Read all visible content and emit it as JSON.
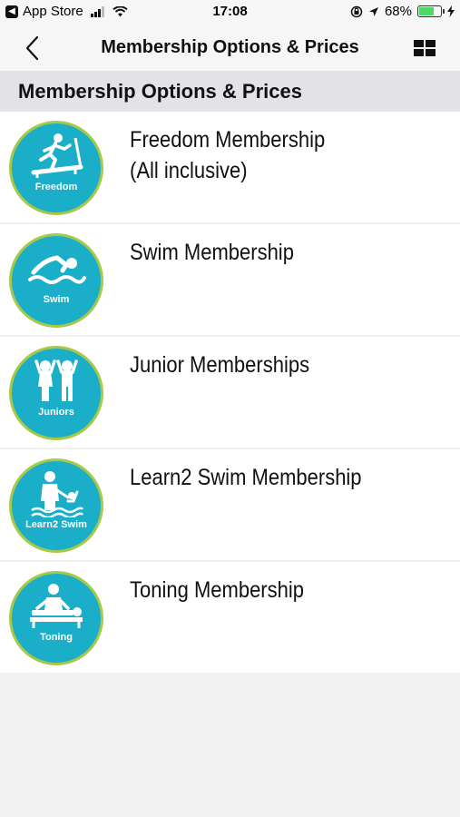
{
  "status_bar": {
    "back_app_label": "App Store",
    "time": "17:08",
    "battery_percent": "68%",
    "battery_level": 0.68
  },
  "nav": {
    "title": "Membership Options & Prices"
  },
  "section": {
    "title": "Membership Options & Prices"
  },
  "colors": {
    "icon_bg": "#1aaec8",
    "icon_ring": "#a6c94a",
    "battery": "#4cd964"
  },
  "memberships": [
    {
      "title": "Freedom Membership",
      "subtitle": "(All inclusive)",
      "caption": "Freedom",
      "icon": "treadmill-icon"
    },
    {
      "title": "Swim Membership",
      "subtitle": "",
      "caption": "Swim",
      "icon": "swimmer-icon"
    },
    {
      "title": "Junior Memberships",
      "subtitle": "",
      "caption": "Juniors",
      "icon": "children-icon"
    },
    {
      "title": "Learn2 Swim Membership",
      "subtitle": "",
      "caption": "Learn2 Swim",
      "icon": "learn-to-swim-icon"
    },
    {
      "title": "Toning Membership",
      "subtitle": "",
      "caption": "Toning",
      "icon": "toning-table-icon"
    }
  ]
}
